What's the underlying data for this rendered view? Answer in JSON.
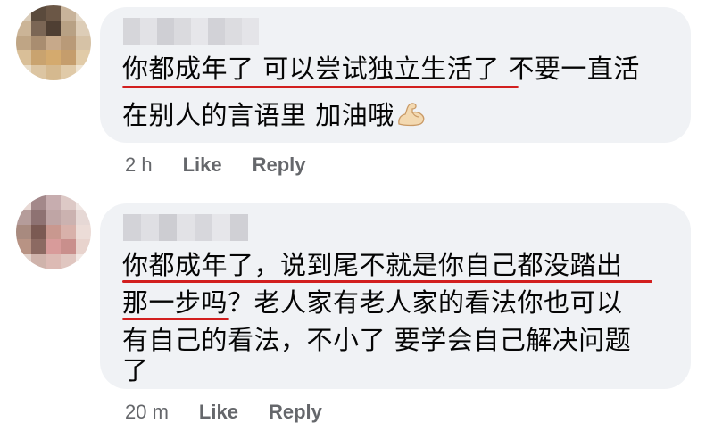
{
  "comments": [
    {
      "lines": [
        "你都成年了 可以尝试独立生活了 不要一直活",
        "在别人的言语里 加油哦"
      ],
      "emoji_icon": "flexed-biceps-icon",
      "time": "2 h",
      "like_label": "Like",
      "reply_label": "Reply"
    },
    {
      "lines": [
        "你都成年了，说到尾不就是你自己都没踏出",
        "那一步吗？老人家有老人家的看法你也可以",
        "有自己的看法，不小了 要学会自己解决问题",
        "了"
      ],
      "time": "20 m",
      "like_label": "Like",
      "reply_label": "Reply"
    }
  ],
  "colors": {
    "bubble": "#f0f2f5",
    "underline": "#d21f1f",
    "meta_text": "#65676b"
  }
}
